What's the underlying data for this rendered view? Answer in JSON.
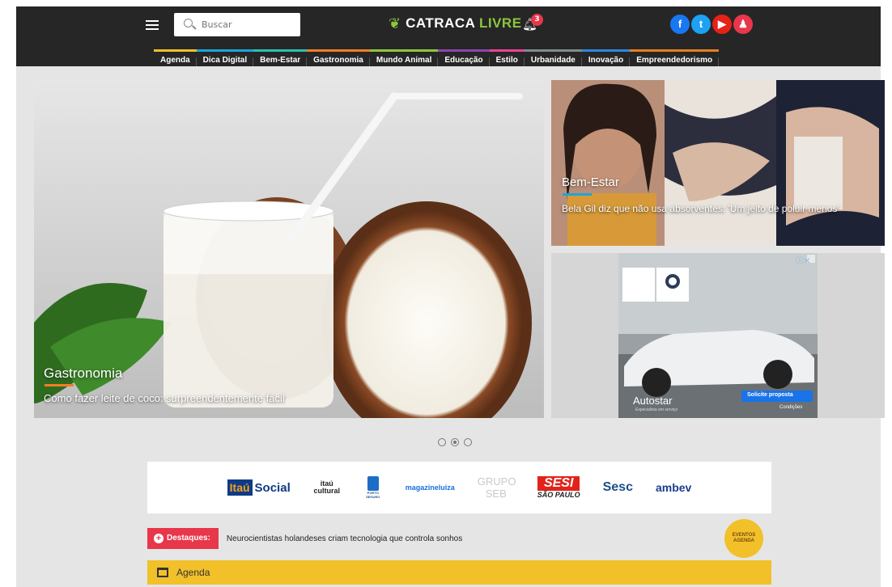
{
  "header": {
    "search_placeholder": "Buscar",
    "logo_prefix": "CATRACA",
    "logo_suffix": "LIVRE",
    "notifications_count": "3",
    "social": [
      {
        "name": "facebook-icon",
        "glyph": "f",
        "color": "#1877f2"
      },
      {
        "name": "twitter-icon",
        "glyph": "t",
        "color": "#1da1f2"
      },
      {
        "name": "youtube-icon",
        "glyph": "▶",
        "color": "#e62117"
      },
      {
        "name": "user-icon",
        "glyph": "♟",
        "color": "#e8374a"
      }
    ]
  },
  "nav": [
    {
      "label": "Agenda",
      "color": "#f2c029"
    },
    {
      "label": "Dica Digital",
      "color": "#1aa6d9"
    },
    {
      "label": "Bem-Estar",
      "color": "#2dbfb0"
    },
    {
      "label": "Gastronomia",
      "color": "#ef7e27"
    },
    {
      "label": "Mundo Animal",
      "color": "#8dc63f"
    },
    {
      "label": "Educação",
      "color": "#8e44ad"
    },
    {
      "label": "Estilo",
      "color": "#e84393"
    },
    {
      "label": "Urbanidade",
      "color": "#7f8c8d"
    },
    {
      "label": "Inovação",
      "color": "#2e86de"
    },
    {
      "label": "Empreendedorismo",
      "color": "#e67e22"
    }
  ],
  "hero": {
    "category": "Gastronomia",
    "category_color": "#ef7e27",
    "title": "Como fazer leite de coco: surpreendentemente fácil"
  },
  "side_story": {
    "category": "Bem-Estar",
    "category_color": "#2dbfb0",
    "title": "Bela Gil diz que não usa absorventes: 'Um jeito de poluir menos'"
  },
  "ad": {
    "brand": "Autostar",
    "tagline": "Especialista em serviço",
    "cta": "Solicite proposta",
    "conditions": "Condições"
  },
  "carousel": {
    "active_index": 1,
    "count": 3
  },
  "sponsors": {
    "itau_badge": "Itaú",
    "itau_social": "Social",
    "itau_cultural": "itaú cultural",
    "porto": "PORTO SEGURO",
    "magazine": "magazineluiza",
    "grupo_seb": "GRUPO SEB",
    "sesi": "SESI",
    "sesi_sp": "SÃO PAULO",
    "sesc": "Sesc",
    "ambev": "ambev"
  },
  "destaques": {
    "label": "Destaques:",
    "text": "Neurocientistas holandeses criam tecnologia que controla sonhos"
  },
  "eventos": {
    "line1": "EVENTOS",
    "line2": "AGENDA"
  },
  "agenda": {
    "label": "Agenda"
  }
}
